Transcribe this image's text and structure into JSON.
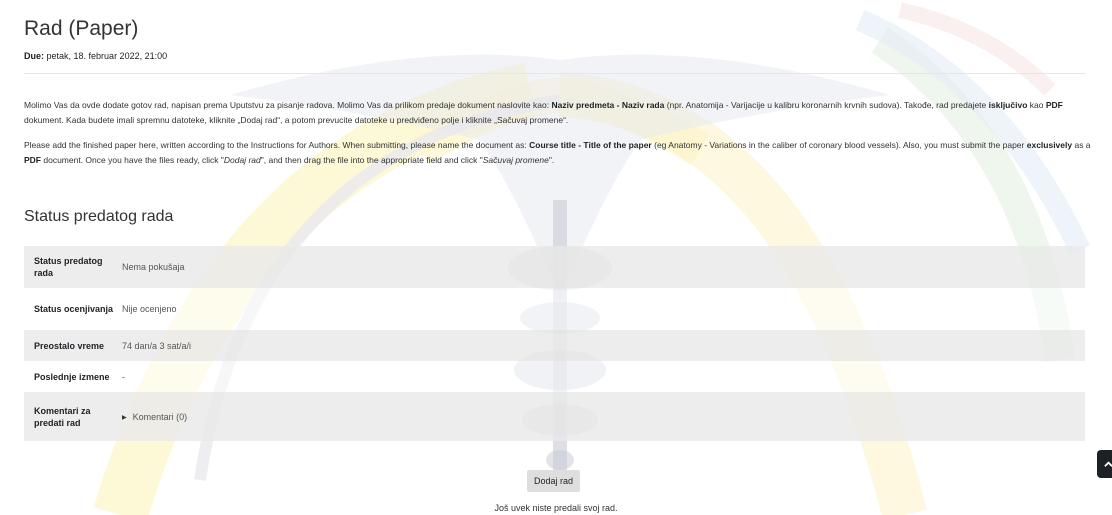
{
  "assignment": {
    "title": "Rad (Paper)",
    "due_label": "Due:",
    "due_value": "petak, 18. februar 2022, 21:00"
  },
  "intro": {
    "sr": {
      "t1": "Molimo Vas da ovde dodate gotov rad, napisan prema Uputstvu za pisanje radova. Molimo Vas da prilikom predaje dokument naslovite kao: ",
      "b1": "Naziv predmeta - Naziv rada",
      "t2": " (npr. Anatomija - Varijacije u kalibru koronarnih krvnih sudova). Takođe, rad predajete ",
      "b2": "isključivo",
      "t3": " kao ",
      "b3": "PDF",
      "t4": " dokument. Kada budete imali spremnu datoteke, kliknite „Dodaj rad“, a potom prevucite datoteke u predviđeno polje i kliknite „Sačuvaj promene“."
    },
    "en": {
      "t1": "Please add the finished paper here, written according to the Instructions for Authors. When submitting, please name the document as: ",
      "b1": "Course title - Title of the paper",
      "t2": " (eg Anatomy - Variations in the caliber of coronary blood vessels). Also, you must submit the paper ",
      "b2": "exclusively",
      "t3": " as a ",
      "b3": "PDF",
      "t4": " document. Once you have the files ready, click \"",
      "i1": "Dodaj rad",
      "t5": "\", and then drag the file into the appropriate field and click \"",
      "i2": "Sačuvaj promene",
      "t6": "\"."
    }
  },
  "status": {
    "heading": "Status predatog rada",
    "rows": [
      {
        "label": "Status predatog rada",
        "value": "Nema pokušaja"
      },
      {
        "label": "Status ocenjivanja",
        "value": "Nije ocenjeno"
      },
      {
        "label": "Preostalo vreme",
        "value": "74 dan/a 3 sat/a/i"
      },
      {
        "label": "Poslednje izmene",
        "value": "-"
      },
      {
        "label": "Komentari za predati rad",
        "value": "Komentari (0)"
      }
    ]
  },
  "actions": {
    "add_submission": "Dodaj rad",
    "not_submitted_notice": "Još uvek niste predali svoj rad."
  },
  "icons": {
    "caret": "caret-right-icon",
    "floating": "chevron-up-icon"
  }
}
